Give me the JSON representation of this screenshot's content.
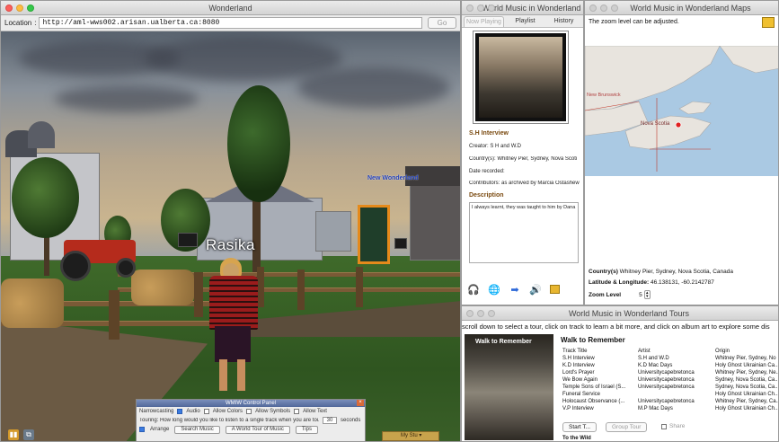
{
  "wonderland": {
    "title": "Wonderland",
    "location_label": "Location",
    "location_url": "http://aml-wws002.arisan.ualberta.ca:8080",
    "go_label": "Go",
    "avatar_name": "Rasika",
    "portal_label": "New Wonderland",
    "control_panel": {
      "title": "WMIW Control Panel",
      "row1_label": "Narrowcasting",
      "opt_audio": "Audio",
      "opt_colors": "Allow Colors",
      "opt_symbols": "Allow Symbols",
      "opt_text": "Allow Text",
      "touring_text": "Touring: How long would you like to listen to a single track when you are touring?",
      "seconds_value": "30",
      "seconds_label": "seconds",
      "arrange_label": "Arrange",
      "search_music": "Search Music",
      "world_tour": "A World Tour of Music",
      "tips": "Tips"
    },
    "mystuff_label": "My Stu"
  },
  "info": {
    "title": "World Music in Wonderland",
    "tab_current": "Now Playing",
    "tab_playlist": "Playlist",
    "tab_history": "History",
    "track_title": "S.H Interview",
    "creator": "Creator: S H and W.D",
    "country": "Country(s):   Whitney Pier, Sydney, Nova Scoti",
    "date": "Date recorded:",
    "contributors": "Contributors:   as archived by Marcia Ostashew",
    "description_label": "Description",
    "description_text": "I always learnt, they was taught to him by Dana"
  },
  "map": {
    "title": "World Music in Wonderland Maps",
    "message": "The zoom level can be adjusted.",
    "label_brunswick": "New Brunswick",
    "label_nova": "Nova Scotia",
    "country_label": "Country(s)",
    "country_value": "Whitney Pier, Sydney, Nova Scotia, Canada",
    "latlng_label": "Latitude & Longitude:",
    "latlng_value": "46.138131, -60.2142787",
    "zoom_label": "Zoom Level",
    "zoom_value": "5"
  },
  "tours": {
    "title": "World Music in Wonderland Tours",
    "instructions": "scroll down to select a tour, click on track to learn a bit more, and click on album art to explore some dis",
    "album_text": "Walk to Remember",
    "tour_title": "Walk to Remember",
    "headers": [
      "Track Title",
      "Artist",
      "Origin"
    ],
    "rows": [
      [
        "S.H Interview",
        "S.H and W.D",
        "Whitney Pier, Sydney, No"
      ],
      [
        "K.D Interview",
        "K.D Mac Days",
        "Holy Ghost Ukrainian Ca..."
      ],
      [
        "Lord's Prayer",
        "Universitycapebretonca",
        "Whitney Pier, Sydney, Ne..."
      ],
      [
        "We Bow Again",
        "Universitycapebretonca",
        "Sydney, Nova Scotia, Ca..."
      ],
      [
        "Temple Sons of Israel (S...",
        "Universitycapebretonca",
        "Sydney, Nova Scotia, Ca..."
      ],
      [
        "Funeral Service",
        "",
        "Holy Ghost Ukrainian Ch..."
      ],
      [
        "Holocaust Observance (...",
        "Universitycapebretonca",
        "Whitney Pier, Sydney, Ca..."
      ],
      [
        "V.P Interview",
        "M.P Mac Days",
        "Holy Ghost Ukrainian Ch..."
      ]
    ],
    "start_btn": "Start T...",
    "group_btn": "Group Tour",
    "share_label": "Share",
    "next_tour": "To the Wild"
  }
}
